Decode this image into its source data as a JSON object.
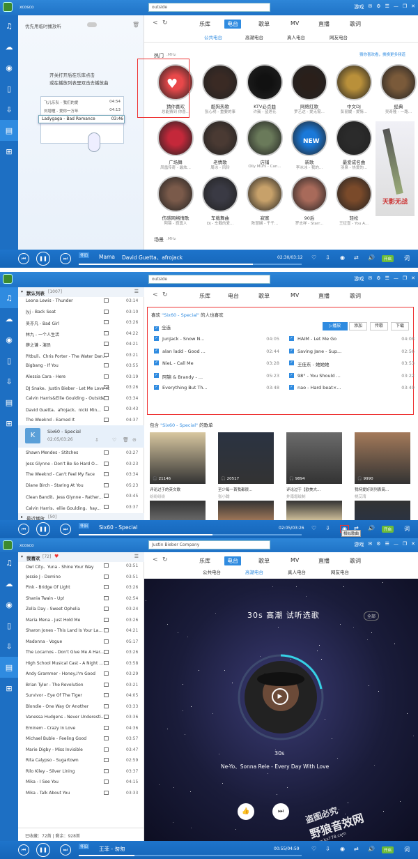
{
  "p1": {
    "brand": "xcosco",
    "search": "outside",
    "top_icons": [
      "游戏",
      "✉",
      "⚙",
      "☰",
      "—",
      "❐",
      "✕"
    ],
    "nav": [
      "乐库",
      "电台",
      "歌单",
      "MV",
      "直播",
      "歌词"
    ],
    "sub": [
      "公共电台",
      "高潮电台",
      "真人电台",
      "网友电台"
    ],
    "left_title": "优先用临时播放听",
    "hint1": "开关打开后在乐库点击",
    "hint2": "或在播放列表里双击去播放曲",
    "mini": [
      {
        "n": "飞儿乐队 - 我们的爱",
        "t": "04:54"
      },
      {
        "n": "刘增瞳 - 爱你一万年",
        "t": "04:13"
      },
      {
        "n": "Ladygaga - Bad Romance",
        "t": "03:46"
      }
    ],
    "section_hot": "热门",
    "section_hot_unit": ".MHz",
    "recommend_link": "猜你喜欢看，换换更多频道",
    "section_scene": "场景",
    "section_scene_unit": ".MHz",
    "cards": [
      [
        "猜你喜欢",
        "总能猜到 你喜..."
      ],
      [
        "酷狗热歌",
        "张心玥 - 重要的事"
      ],
      [
        "KTV必点曲",
        "许巍 - 蓝莲花"
      ],
      [
        "网络红歌",
        "罗艺达 - 爱无需..."
      ],
      [
        "中文DJ",
        "彭丽媛 - 爱情..."
      ],
      [
        "经典",
        "吴奇隆 - 一路..."
      ],
      [
        "广场舞",
        "凤凰传奇 - 最炫..."
      ],
      [
        "老情歌",
        "周冰 - 风铃"
      ],
      [
        "店铺",
        "Olly Murs - Can..."
      ],
      [
        "新歌",
        "李冰冰 - 我的..."
      ],
      [
        "最爱成名曲",
        "羽泉 - 热爱的..."
      ],
      [
        "伤感网络情歌",
        "阿锦 - 寂寞人"
      ],
      [
        "车载舞曲",
        "DJ - 车载的爱..."
      ],
      [
        "寂寞",
        "陈慧娴 - 千千..."
      ],
      [
        "90后",
        "罗志祥 - Starr..."
      ],
      [
        "轻松",
        "王征宣 - You A..."
      ]
    ],
    "ad_title": "天影无战",
    "player": {
      "mode": "怀旧",
      "title": "Mama",
      "artist": "David Guetta、afrojack",
      "time": "02:30/03:12",
      "progress": 0.78,
      "on": "开启"
    }
  },
  "p2": {
    "brand": "xcosco",
    "search": "outside",
    "nav": [
      "乐库",
      "电台",
      "歌单",
      "MV",
      "直播",
      "歌词"
    ],
    "list_title": "默认列表",
    "list_count": "[1007]",
    "rows": [
      [
        "Leona Lewis - Thunder",
        "03:14"
      ],
      [
        "Jyj - Back Seat",
        "03:10"
      ],
      [
        "吴亦凡 - Bad Girl",
        "03:26"
      ],
      [
        "林九 - 一个人生活",
        "04:22"
      ],
      [
        "薛之谦 - 演员",
        "04:21"
      ],
      [
        "Pitbull、Chris Porter - The Water Dan...",
        "03:21"
      ],
      [
        "Bigbang - If You",
        "03:55"
      ],
      [
        "Alessia Cara - Here",
        "03:19"
      ],
      [
        "DJ Snake、Justin Bieber - Let Me Love You",
        "03:26"
      ],
      [
        "Calvin Harris&Ellie Goulding - Outside",
        "03:34"
      ],
      [
        "David Guetta、afrojack、nicki Min...",
        "03:43"
      ],
      [
        "The Weeknd - Earned It",
        "04:37"
      ]
    ],
    "playing": {
      "n": "Six60 - Special",
      "t": "02:05/03:26"
    },
    "rows2": [
      [
        "Shawn Mendes - Stitches",
        "03:27"
      ],
      [
        "Jess Glynne - Don't Be So Hard O...",
        "03:23"
      ],
      [
        "The Weeknd - Can't Feel My Face",
        "03:34"
      ],
      [
        "Diane Birch - Staring At You",
        "05:23"
      ],
      [
        "Clean Bandit、Jess Glynne - Rather...",
        "03:45"
      ],
      [
        "Calvin Harris、ellie Goulding、hay...",
        "03:37"
      ]
    ],
    "recent": "最近播放",
    "recent_count": "[50]",
    "like_pre": "喜欢",
    "like_song": "\"Six60 - Special\"",
    "like_post": "的人也喜欢",
    "select_all": "全选",
    "btns": [
      "▷播放",
      "添加",
      "传歌",
      "下载"
    ],
    "songs": [
      [
        "JunJack - Snow N...",
        "04:05",
        "HAIM - Let Me Go",
        "04:08"
      ],
      [
        "alan ladd - Good ...",
        "02:44",
        "Saving Jane - Sup...",
        "02:56"
      ],
      [
        "NieL - Call Me",
        "03:28",
        "王佳东 - 她她她",
        "03:53"
      ],
      [
        "阿锦 & Brandy - ...",
        "05:23",
        "98° - You Should ...",
        "03:22"
      ],
      [
        "Everything But Th...",
        "03:48",
        "nao - Hard beat×...",
        "03:49"
      ]
    ],
    "inc_pre": "包含",
    "inc_song": "\"Six60 - Special\"",
    "inc_post": "的歌单",
    "albums": [
      {
        "c": "21146",
        "t": "评论过于的英文歌",
        "u": "纷纷纷纷"
      },
      {
        "c": "20517",
        "t": "至少每一首我都很...",
        "u": "张小翰"
      },
      {
        "c": "9894",
        "t": "评论过于【欧美大...",
        "u": "井南增绘制"
      },
      {
        "c": "9990",
        "t": "我特爱好到列表简...",
        "u": "桃艾湾"
      }
    ],
    "tooltip": "相似歌曲",
    "player": {
      "mode": "怀旧",
      "title": "Six60 - Special",
      "time": "02:05/03:26",
      "progress": 0.6,
      "on": "开启"
    }
  },
  "p3": {
    "brand": "xcosco",
    "search": "Justin Bieber Company",
    "nav": [
      "乐库",
      "电台",
      "歌单",
      "MV",
      "直播",
      "歌词"
    ],
    "sub": [
      "公共电台",
      "高潮电台",
      "真人电台",
      "网友电台"
    ],
    "list_title": "我喜欢",
    "list_count": "[72]",
    "rows": [
      [
        "Owl City、Yuna - Shine Your Way",
        "03:51"
      ],
      [
        "Jessie J - Domino",
        "03:51"
      ],
      [
        "Pink - Bridge Of Light",
        "03:26"
      ],
      [
        "Shania Twain - Up!",
        "02:54"
      ],
      [
        "Zella Day - Sweet Ophelia",
        "03:24"
      ],
      [
        "Maria Mena - Just Hold Me",
        "03:26"
      ],
      [
        "Sharon Jones - This Land Is Your La...",
        "04:21"
      ],
      [
        "Madonna - Vogue",
        "05:17"
      ],
      [
        "The Locarnos - Don't Give Me A Har...",
        "03:26"
      ],
      [
        "High School Musical Cast - A Night ...",
        "03:58"
      ],
      [
        "Andy Grammer - Honey,I'm Good",
        "03:29"
      ],
      [
        "Brian Tyler - The Revolution",
        "03:21"
      ],
      [
        "Survivor - Eye Of The Tiger",
        "04:05"
      ],
      [
        "Blondie - One Way Or Another",
        "03:33"
      ],
      [
        "Vanessa Hudgens - Never Underesti...",
        "03:36"
      ],
      [
        "Eminem - Crazy In Love",
        "04:36"
      ],
      [
        "Michael Buble - Feeling Good",
        "03:57"
      ],
      [
        "Marie Digby - Miss Invisible",
        "03:47"
      ],
      [
        "Rita Calypso - Sugartown",
        "02:59"
      ],
      [
        "Rilo Kiley - Silver Lining",
        "03:37"
      ],
      [
        "Mika - I See You",
        "04:15"
      ],
      [
        "Mika - Talk About You",
        "03:33"
      ]
    ],
    "footer": "已收藏：72首  |  剩余：928首",
    "radio_title": "30s 高潮  试听选歌",
    "all": "全部",
    "album_label": "30s",
    "song": "Ne-Yo、Sonna Rele - Every Day With Love",
    "wm1": "盗图必究",
    "wm2": "野狼音效网",
    "wm3": "www.kx778.com",
    "player": {
      "mode": "怀旧",
      "title": "王菲 - 匆匆",
      "time": "00:55/04:59",
      "progress": 0.25,
      "on": "开启"
    }
  }
}
